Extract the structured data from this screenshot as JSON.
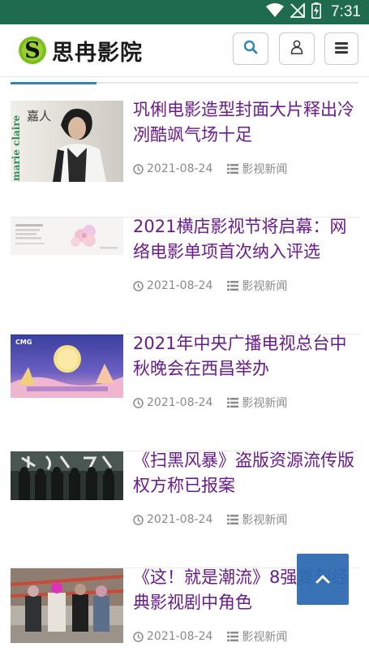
{
  "status_bar": {
    "time": "7:31",
    "icons": [
      "wifi-icon",
      "no-signal-icon",
      "battery-charging-icon"
    ]
  },
  "header": {
    "logo_letter": "S",
    "site_name": "思冉影院",
    "buttons": [
      "search-icon",
      "user-icon",
      "menu-icon"
    ]
  },
  "articles": [
    {
      "title": "巩俐电影造型封面大片释出冷冽酷飒气场十足",
      "date": "2021-08-24",
      "category": "影视新闻",
      "thumb_text": "marie claire"
    },
    {
      "title": "2021横店影视节将启幕：网络电影单项首次纳入评选",
      "date": "2021-08-24",
      "category": "影视新闻"
    },
    {
      "title": "2021年中央广播电视总台中秋晚会在西昌举办",
      "date": "2021-08-24",
      "category": "影视新闻",
      "thumb_text": "CMG"
    },
    {
      "title": "《扫黑风暴》盗版资源流传版权方称已报案",
      "date": "2021-08-24",
      "category": "影视新闻"
    },
    {
      "title": "《这！就是潮流》8强复刻经典影视剧中角色",
      "date": "2021-08-24",
      "category": "影视新闻"
    }
  ],
  "colors": {
    "status_bar": "#1e6b4d",
    "title": "#6a1b8c",
    "accent": "#2d86b6",
    "back_to_top": "#2e6bb2"
  }
}
